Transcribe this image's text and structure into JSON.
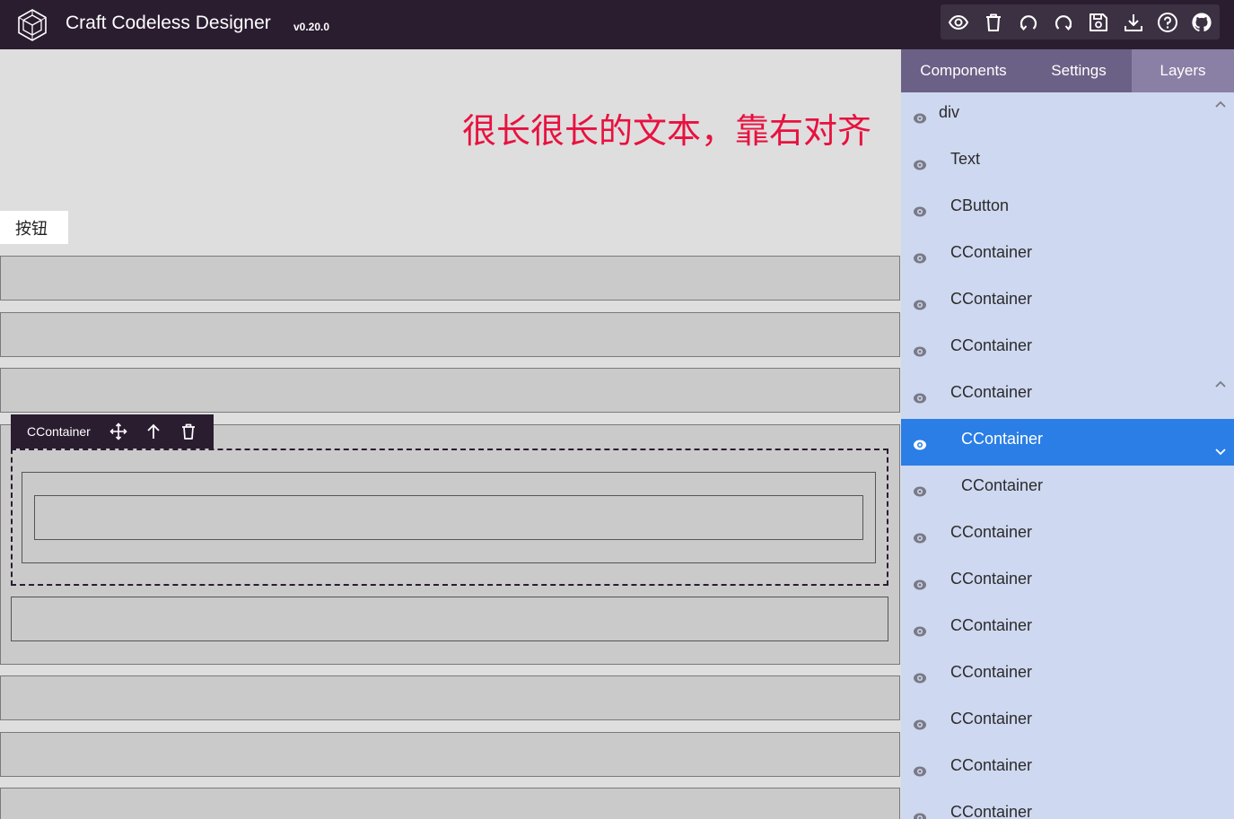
{
  "header": {
    "title": "Craft Codeless Designer",
    "version": "v0.20.0",
    "toolbar_icons": [
      "eye-icon",
      "trash-icon",
      "undo-icon",
      "redo-icon",
      "save-icon",
      "download-icon",
      "help-icon",
      "github-icon"
    ]
  },
  "canvas": {
    "long_text": "很长很长的文本，靠右对齐",
    "button_label": "按钮",
    "selection_toolbar": {
      "label": "CContainer",
      "icons": [
        "move-icon",
        "arrow-up-icon",
        "trash-icon"
      ]
    }
  },
  "panel": {
    "tabs": [
      {
        "label": "Components",
        "active": false
      },
      {
        "label": "Settings",
        "active": false
      },
      {
        "label": "Layers",
        "active": true
      }
    ],
    "layers": [
      {
        "name": "div",
        "depth": 0,
        "selected": false,
        "chevron": "up"
      },
      {
        "name": "Text",
        "depth": 1,
        "selected": false
      },
      {
        "name": "CButton",
        "depth": 1,
        "selected": false
      },
      {
        "name": "CContainer",
        "depth": 1,
        "selected": false
      },
      {
        "name": "CContainer",
        "depth": 1,
        "selected": false
      },
      {
        "name": "CContainer",
        "depth": 1,
        "selected": false
      },
      {
        "name": "CContainer",
        "depth": 1,
        "selected": false,
        "chevron": "up"
      },
      {
        "name": "CContainer",
        "depth": 2,
        "selected": true,
        "chevron": "down"
      },
      {
        "name": "CContainer",
        "depth": 2,
        "selected": false
      },
      {
        "name": "CContainer",
        "depth": 1,
        "selected": false
      },
      {
        "name": "CContainer",
        "depth": 1,
        "selected": false
      },
      {
        "name": "CContainer",
        "depth": 1,
        "selected": false
      },
      {
        "name": "CContainer",
        "depth": 1,
        "selected": false
      },
      {
        "name": "CContainer",
        "depth": 1,
        "selected": false
      },
      {
        "name": "CContainer",
        "depth": 1,
        "selected": false
      },
      {
        "name": "CContainer",
        "depth": 1,
        "selected": false
      }
    ]
  },
  "colors": {
    "header_bg": "#2a1d30",
    "accent_text": "#e8113f",
    "panel_bg": "#ced8f0",
    "selected_layer": "#2a7ee6",
    "tab_bar": "#6b6186",
    "active_tab": "#8a7fa5"
  }
}
